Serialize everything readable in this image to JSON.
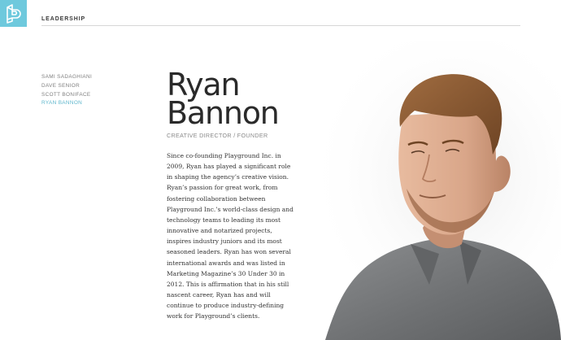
{
  "header": {
    "logo_icon": "p-monogram-icon",
    "section_label": "LEADERSHIP"
  },
  "sidebar": {
    "items": [
      {
        "label": "SAMI SADAGHIANI",
        "active": false
      },
      {
        "label": "DAVE SENIOR",
        "active": false
      },
      {
        "label": "SCOTT BONIFACE",
        "active": false
      },
      {
        "label": "RYAN BANNON",
        "active": true
      }
    ]
  },
  "profile": {
    "first_name": "Ryan",
    "last_name": "Bannon",
    "role": "CREATIVE DIRECTOR / FOUNDER",
    "bio_lines": [
      "Since co-founding Playground Inc. in",
      "2009, Ryan has played a significant role",
      "in shaping the agency’s creative vision.",
      "Ryan’s passion for great work, from",
      "fostering collaboration between",
      "Playground Inc.’s world-class design and",
      "technology teams to leading its most",
      "innovative and notarized projects,",
      "inspires industry juniors and its most",
      "seasoned leaders. Ryan has won several",
      "international awards and was listed in",
      "Marketing Magazine’s 30 Under 30 in",
      "2012. This is affirmation that in his still",
      "nascent career, Ryan has and will",
      "continue to produce industry-defining",
      "work for Playground’s clients."
    ]
  },
  "colors": {
    "accent": "#6ec9dd",
    "active_nav": "#5fb7cd",
    "shirt": "#7b7d7f",
    "skin": "#d9a689",
    "hair": "#8a5a34"
  }
}
